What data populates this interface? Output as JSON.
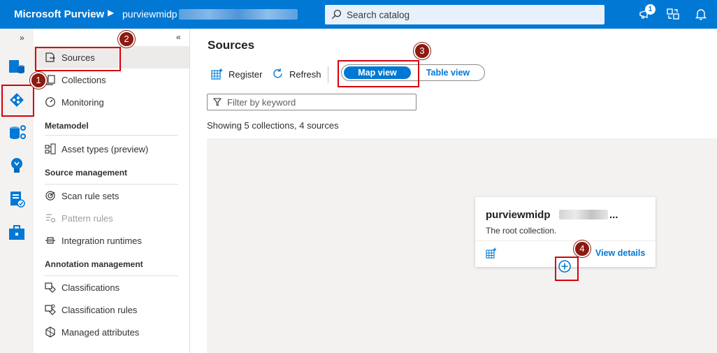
{
  "topbar": {
    "brand": "Microsoft Purview",
    "account": "purviewmidp",
    "search_placeholder": "Search catalog",
    "notification_count": "1"
  },
  "rail": {
    "expand": "»",
    "items": [
      "data-catalog",
      "data-map",
      "data-estate-insights",
      "data-policy",
      "management"
    ]
  },
  "menu": {
    "collapse": "«",
    "items": {
      "sources": "Sources",
      "collections": "Collections",
      "monitoring": "Monitoring",
      "metamodel_header": "Metamodel",
      "asset_types": "Asset types (preview)",
      "source_mgmt_header": "Source management",
      "scan_rule_sets": "Scan rule sets",
      "pattern_rules": "Pattern rules",
      "integration_runtimes": "Integration runtimes",
      "annotation_header": "Annotation management",
      "classifications": "Classifications",
      "classification_rules": "Classification rules",
      "managed_attributes": "Managed attributes"
    }
  },
  "main": {
    "title": "Sources",
    "register": "Register",
    "refresh": "Refresh",
    "map_view": "Map view",
    "table_view": "Table view",
    "filter_placeholder": "Filter by keyword",
    "showing": "Showing 5 collections, 4 sources",
    "card": {
      "title": "purviewmidp",
      "ellipsis": "...",
      "description": "The root collection.",
      "view_details": "View details"
    }
  },
  "callouts": [
    "1",
    "2",
    "3",
    "4"
  ],
  "colors": {
    "accent": "#0078d4",
    "callout": "#8b1a10",
    "highlight": "#d6000f"
  }
}
